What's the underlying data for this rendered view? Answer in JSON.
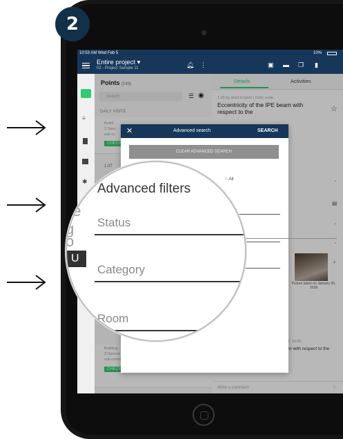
{
  "step_number": "2",
  "status_bar": {
    "time_date": "10:53 AM  Wed Feb 5",
    "battery": "10%"
  },
  "toolbar": {
    "title": "Entire project",
    "subtitle": "02 - Project Sample 11"
  },
  "points_panel": {
    "title": "Points",
    "count": "(143)",
    "search_placeholder": "Search",
    "section": "DAILY VISITE",
    "card1_lines": [
      "Buildi",
      "3 Spec",
      "sub co"
    ],
    "card1_tag": "CHECK",
    "card2_ref": "1.07",
    "card3_lines": [
      "Building",
      "3 Special Techniques / 3.3 Electricity",
      "sub contractor"
    ],
    "card3_tag": "CHECKED",
    "fab": "+"
  },
  "detail_panel": {
    "tab_details": "Details",
    "tab_activities": "Activities",
    "meta": "1.05 by wlad English  |  Daily visite",
    "title": "Eccentricity of the IPE beam with respect to the",
    "picture_caption": "Picture taken on January 26, 2018",
    "activity_date": "y 2018, 16:25",
    "activity_text": "Eccentricity of the IPE beam with respect to the concrete column",
    "comment_placeholder": "Write a comment"
  },
  "modal": {
    "title": "Advanced search",
    "search_button": "SEARCH",
    "clear_button": "CLEAR ADVANCED SEARCH",
    "radio_partial": "ived",
    "radio_all": "All"
  },
  "magnifier": {
    "heading": "Advanced filters",
    "fields": [
      "Status",
      "Category",
      "Room"
    ],
    "ghost_letters": [
      "ne",
      "g",
      "o",
      "U",
      "er"
    ]
  },
  "colors": {
    "brand_navy": "#17375a",
    "accent_green": "#2ecc71",
    "badge": "#12304a"
  }
}
